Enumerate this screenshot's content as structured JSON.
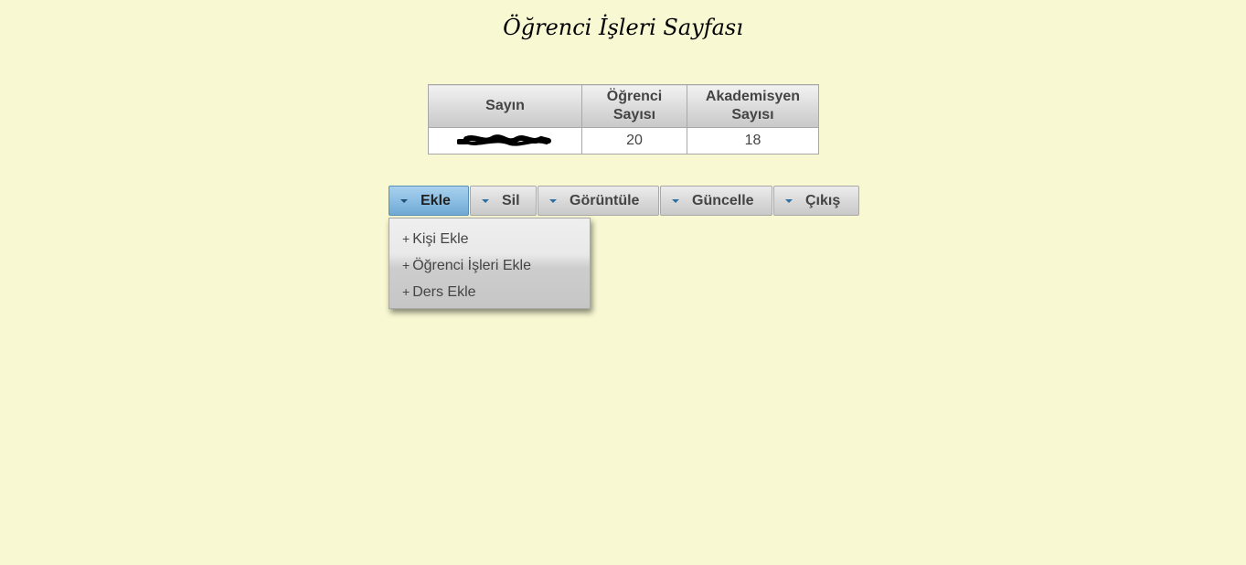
{
  "page": {
    "title": "Öğrenci İşleri Sayfası"
  },
  "table": {
    "headers": [
      "Sayın",
      "Öğrenci Sayısı",
      "Akademisyen Sayısı"
    ],
    "row": {
      "student_count": "20",
      "academic_count": "18"
    }
  },
  "menu": {
    "items": [
      {
        "label": "Ekle"
      },
      {
        "label": "Sil"
      },
      {
        "label": "Görüntüle"
      },
      {
        "label": "Güncelle"
      },
      {
        "label": "Çıkış"
      }
    ],
    "active": "Ekle"
  },
  "dropdown": {
    "items": [
      {
        "icon": "plus-icon",
        "label": "Kişi Ekle"
      },
      {
        "icon": "plus-icon",
        "label": "Öğrenci İşleri Ekle"
      },
      {
        "icon": "plus-icon",
        "label": "Ders Ekle"
      }
    ]
  },
  "colors": {
    "background": "#f8f8d3",
    "active_button": "#8cbee3"
  }
}
